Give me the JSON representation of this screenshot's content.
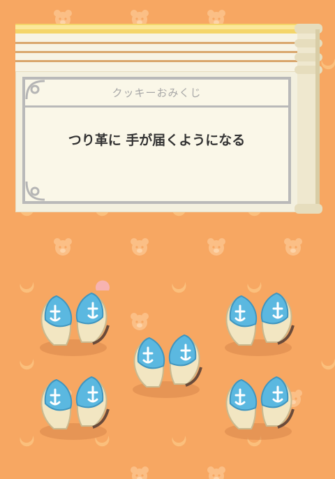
{
  "fortune": {
    "title": "クッキーおみくじ",
    "message": "つり革に 手が届くようになる"
  },
  "cookies": [
    {
      "name": "cookie-half-pair-1"
    },
    {
      "name": "cookie-half-pair-2"
    },
    {
      "name": "cookie-half-pair-3"
    },
    {
      "name": "cookie-half-pair-4"
    },
    {
      "name": "cookie-half-pair-5"
    }
  ],
  "colors": {
    "background": "#f7a762",
    "paper": "#faf7e8",
    "frame": "#b9b9b9",
    "cookie_blue": "#5bb8e0",
    "cookie_shell": "#f2e6c2"
  }
}
